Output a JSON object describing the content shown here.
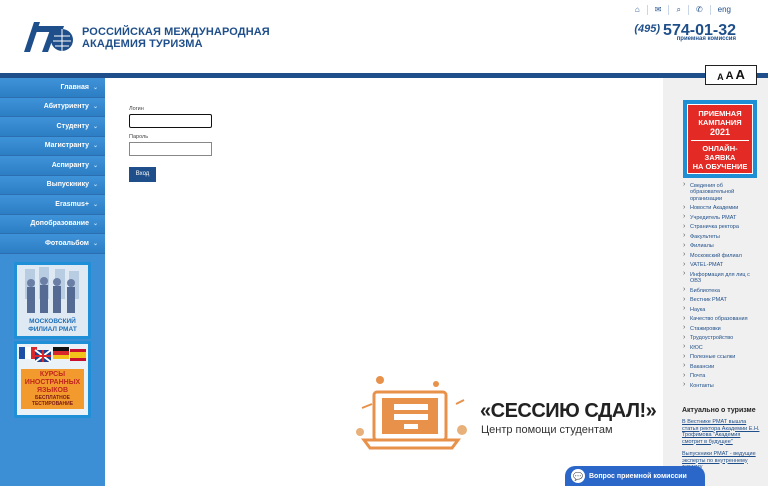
{
  "header": {
    "brand_line1": "РОССИЙСКАЯ МЕЖДУНАРОДНАЯ",
    "brand_line2": "АКАДЕМИЯ ТУРИЗМА",
    "phone_code": "(495)",
    "phone_number": "574-01-32",
    "phone_caption": "приемная комиссия",
    "lang": "eng",
    "font_size_labels": [
      "A",
      "A",
      "A"
    ]
  },
  "nav": [
    "Главная",
    "Абитуриенту",
    "Студенту",
    "Магистранту",
    "Аспиранту",
    "Выпускнику",
    "Erasmus+",
    "Допобразование",
    "Фотоальбом"
  ],
  "banners": {
    "moscow": {
      "line1": "МОСКОВСКИЙ",
      "line2": "ФИЛИАЛ РМАТ"
    },
    "languages": {
      "line1": "КУРСЫ",
      "line2": "ИНОСТРАННЫХ",
      "line3": "ЯЗЫКОВ",
      "line4": "БЕСПЛАТНОЕ",
      "line5": "ТЕСТИРОВАНИЕ"
    }
  },
  "form": {
    "login_label": "Логин",
    "login_value": "",
    "password_label": "Пароль",
    "password_value": "",
    "submit_label": "Вход"
  },
  "campaign": {
    "line1": "ПРИЕМНАЯ",
    "line2": "КАМПАНИЯ",
    "year": "2021",
    "line3": "ОНЛАЙН-ЗАЯВКА",
    "line4": "НА ОБУЧЕНИЕ"
  },
  "right_links": [
    "Сведения об образовательной организации",
    "Новости Академии",
    "Учредитель РМАТ",
    "Страничка ректора",
    "Факультеты",
    "Филиалы",
    "Московский филиал",
    "VATEL-РМАТ",
    "Информация для лиц с ОВЗ",
    "Библиотека",
    "Вестник РМАТ",
    "Наука",
    "Качество образования",
    "Стажировки",
    "Трудоустройство",
    "КЮС",
    "Полезные ссылки",
    "Вакансии",
    "Почта",
    "Контакты"
  ],
  "news": {
    "title": "Актуально о туризме",
    "items": [
      "В Вестнике РМАТ вышла статья ректора Академии Е.Н. Трофимова \"Академия смотрит в будущее\"",
      "Выпускники РМАТ - ведущие эксперты по внутреннему туризму"
    ]
  },
  "promo": {
    "title": "«СЕССИЮ СДАЛ!»",
    "subtitle": "Центр помощи студентам"
  },
  "chat": {
    "label": "Вопрос приемной комиссии"
  },
  "colors": {
    "brand": "#1f4f8a",
    "nav": "#3c8fd4",
    "campaign_red": "#e32a24",
    "promo_orange": "#e8914a",
    "chat": "#2a67c9"
  }
}
